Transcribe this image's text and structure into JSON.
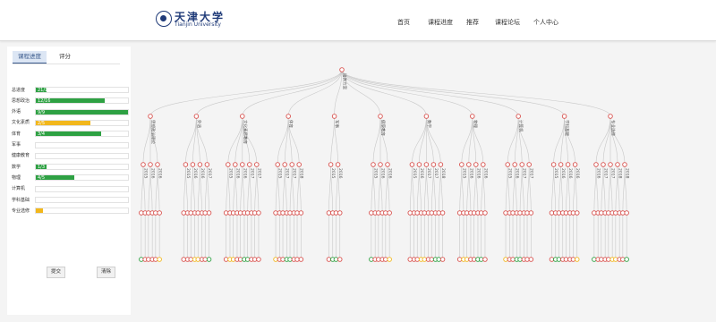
{
  "header": {
    "logo_cn": "天津大学",
    "logo_en": "Tianjin University",
    "nav": [
      "首页",
      "课程进度",
      "推荐",
      "课程论坛",
      "个人中心"
    ]
  },
  "left_panel": {
    "tabs": [
      "课程进度",
      "评分"
    ],
    "rows": [
      {
        "label": "总进度",
        "bar_text": "21/175",
        "fraction": 0.12,
        "color": "#2ea143"
      },
      {
        "label": "思想政治",
        "bar_text": "12/16",
        "fraction": 0.75,
        "color": "#2ea143"
      },
      {
        "label": "外语",
        "bar_text": "9/9",
        "fraction": 1.0,
        "color": "#2ea143"
      },
      {
        "label": "文化素质",
        "bar_text": "2/5",
        "fraction": 0.59,
        "color": "#f2b71c"
      },
      {
        "label": "体育",
        "bar_text": "3/4",
        "fraction": 0.71,
        "color": "#2ea143"
      },
      {
        "label": "军事",
        "bar_text": "",
        "fraction": 0,
        "color": "#2ea143"
      },
      {
        "label": "健康教育",
        "bar_text": "",
        "fraction": 0,
        "color": "#2ea143"
      },
      {
        "label": "数学",
        "bar_text": "1/3",
        "fraction": 0.12,
        "color": "#2ea143"
      },
      {
        "label": "物理",
        "bar_text": "4/5",
        "fraction": 0.42,
        "color": "#2ea143"
      },
      {
        "label": "计算机",
        "bar_text": "",
        "fraction": 0,
        "color": "#2ea143"
      },
      {
        "label": "学科基础",
        "bar_text": "",
        "fraction": 0,
        "color": "#2ea143"
      },
      {
        "label": "专业选修",
        "bar_text": "",
        "fraction": 0.08,
        "color": "#f2b71c"
      }
    ],
    "submit_label": "提交",
    "clear_label": "清除"
  },
  "tree": {
    "root": "培养方案",
    "categories": [
      {
        "name": "思想政治理论",
        "terms": [
          "2015",
          "2016",
          "2016"
        ]
      },
      {
        "name": "外语",
        "terms": [
          "2015",
          "2016",
          "2016",
          "2017"
        ]
      },
      {
        "name": "文化素质教育",
        "terms": [
          "2015",
          "2016",
          "2016",
          "2017",
          "2017"
        ]
      },
      {
        "name": "体育",
        "terms": [
          "2015",
          "2017",
          "2017",
          "2018"
        ]
      },
      {
        "name": "军事",
        "terms": [
          "2015",
          "2016"
        ]
      },
      {
        "name": "健康教育",
        "terms": [
          "2015",
          "2016",
          "2016"
        ]
      },
      {
        "name": "数学",
        "terms": [
          "2015",
          "2016",
          "2017",
          "2017",
          "2018"
        ]
      },
      {
        "name": "物理",
        "terms": [
          "2015",
          "2016",
          "2016",
          "2016"
        ]
      },
      {
        "name": "计算机",
        "terms": [
          "2015",
          "2016",
          "2017",
          "2017"
        ]
      },
      {
        "name": "学科基础",
        "terms": [
          "2015",
          "2016",
          "2016",
          "2016"
        ]
      },
      {
        "name": "专业选修",
        "terms": [
          "2016",
          "2017",
          "2017",
          "2018",
          "2018"
        ]
      }
    ],
    "status_colors": {
      "passed": "#2ea143",
      "in_progress": "#f2b71c",
      "not_started": "#d9534f"
    }
  }
}
